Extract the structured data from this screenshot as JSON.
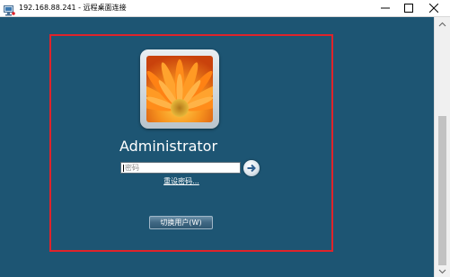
{
  "window": {
    "title": "192.168.88.241 - 远程桌面连接",
    "controls": {
      "minimize_icon": "minimize-icon",
      "maximize_icon": "maximize-icon",
      "close_icon": "close-icon"
    }
  },
  "login": {
    "username": "Administrator",
    "password_placeholder": "密码",
    "password_value": "",
    "reset_password_link": "重设密码...",
    "switch_user_button": "切换用户(W)",
    "avatar_icon": "flower-avatar-icon",
    "submit_icon": "arrow-right-icon"
  },
  "colors": {
    "background": "#1d5573",
    "highlight_border": "#e0232a",
    "titlebar": "#ffffff"
  }
}
